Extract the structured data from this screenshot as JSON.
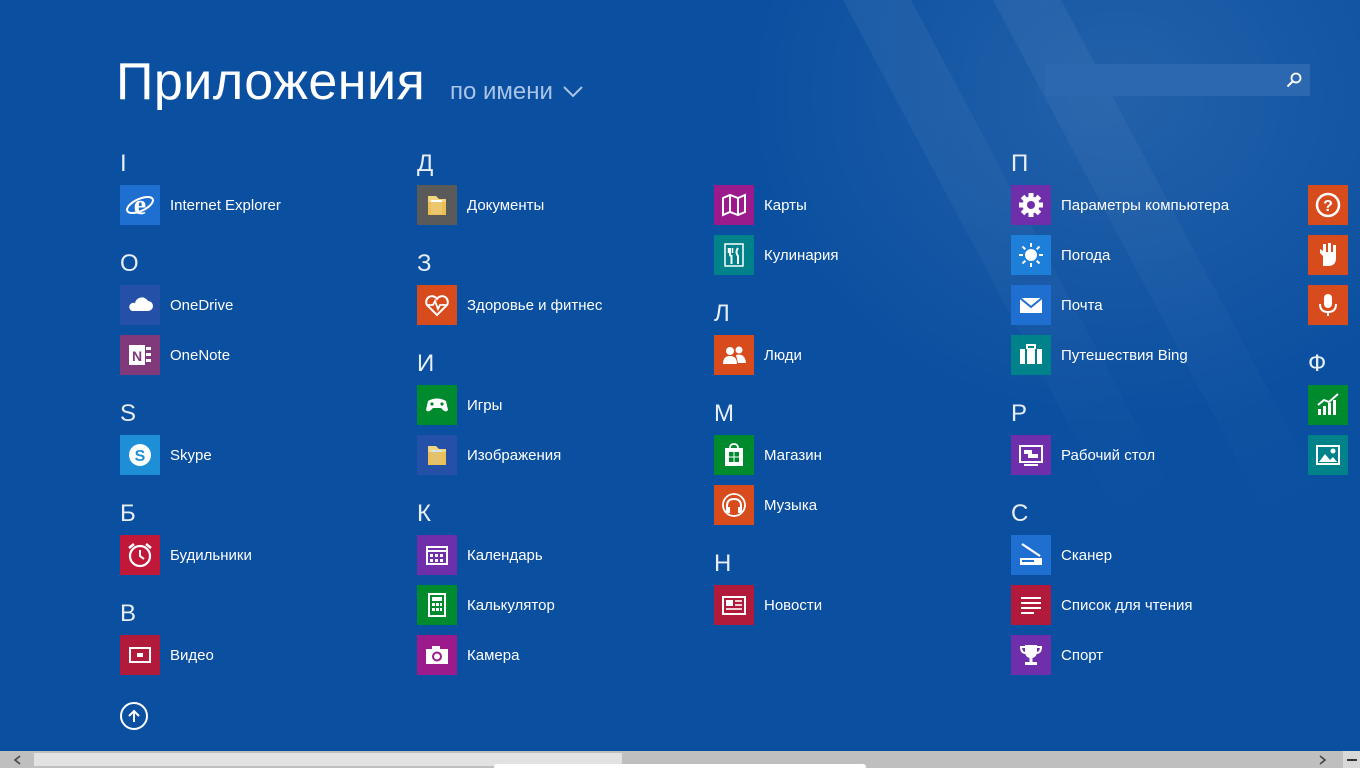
{
  "header": {
    "title": "Приложения",
    "sort_label": "по имени",
    "search_placeholder": ""
  },
  "colors": {
    "background": "#0a4fa0",
    "blue": "#1e6fd0",
    "navy": "#2450a8",
    "purple": "#6f2eaa",
    "magenta": "#9b1a8c",
    "teal": "#00828a",
    "green": "#008a2e",
    "orange": "#d74b1d",
    "red": "#c1183a",
    "gray": "#5a5a5a"
  },
  "sections": {
    "I": {
      "letter": "I"
    },
    "O": {
      "letter": "O"
    },
    "S": {
      "letter": "S"
    },
    "B": {
      "letter": "Б"
    },
    "V": {
      "letter": "В"
    },
    "D": {
      "letter": "Д"
    },
    "Z": {
      "letter": "З"
    },
    "I2": {
      "letter": "И"
    },
    "K": {
      "letter": "К"
    },
    "L": {
      "letter": "Л"
    },
    "M": {
      "letter": "М"
    },
    "N": {
      "letter": "Н"
    },
    "P": {
      "letter": "П"
    },
    "R": {
      "letter": "Р"
    },
    "S2": {
      "letter": "С"
    },
    "F": {
      "letter": "Ф"
    }
  },
  "apps": {
    "internet_explorer": {
      "label": "Internet Explorer",
      "icon": "internet-explorer-icon"
    },
    "onedrive": {
      "label": "OneDrive",
      "icon": "cloud-icon"
    },
    "onenote": {
      "label": "OneNote",
      "icon": "onenote-icon"
    },
    "skype": {
      "label": "Skype",
      "icon": "skype-icon"
    },
    "alarms": {
      "label": "Будильники",
      "icon": "alarm-clock-icon"
    },
    "video": {
      "label": "Видео",
      "icon": "video-icon"
    },
    "documents": {
      "label": "Документы",
      "icon": "folder-icon"
    },
    "health": {
      "label": "Здоровье и фитнес",
      "icon": "heart-pulse-icon"
    },
    "games": {
      "label": "Игры",
      "icon": "gamepad-icon"
    },
    "pictures": {
      "label": "Изображения",
      "icon": "folder-icon"
    },
    "calendar": {
      "label": "Календарь",
      "icon": "calendar-icon"
    },
    "calculator": {
      "label": "Калькулятор",
      "icon": "calculator-icon"
    },
    "camera": {
      "label": "Камера",
      "icon": "camera-icon"
    },
    "maps": {
      "label": "Карты",
      "icon": "map-icon"
    },
    "food": {
      "label": "Кулинария",
      "icon": "fork-knife-icon"
    },
    "people": {
      "label": "Люди",
      "icon": "people-icon"
    },
    "store": {
      "label": "Магазин",
      "icon": "store-bag-icon"
    },
    "music": {
      "label": "Музыка",
      "icon": "headphones-icon"
    },
    "news": {
      "label": "Новости",
      "icon": "newspaper-icon"
    },
    "pc_settings": {
      "label": "Параметры компьютера",
      "icon": "gear-icon"
    },
    "weather": {
      "label": "Погода",
      "icon": "sun-icon"
    },
    "mail": {
      "label": "Почта",
      "icon": "envelope-icon"
    },
    "travel": {
      "label": "Путешествия Bing",
      "icon": "suitcase-icon"
    },
    "desktop": {
      "label": "Рабочий стол",
      "icon": "desktop-icon"
    },
    "scanner": {
      "label": "Сканер",
      "icon": "scanner-icon"
    },
    "reading_list": {
      "label": "Список для чтения",
      "icon": "reading-list-icon"
    },
    "sport": {
      "label": "Спорт",
      "icon": "trophy-icon"
    },
    "help": {
      "icon": "help-icon"
    },
    "app_x2": {
      "icon": "hand-icon"
    },
    "app_x3": {
      "icon": "microphone-icon"
    },
    "finance": {
      "icon": "chart-icon"
    },
    "photos": {
      "icon": "photo-icon"
    }
  }
}
